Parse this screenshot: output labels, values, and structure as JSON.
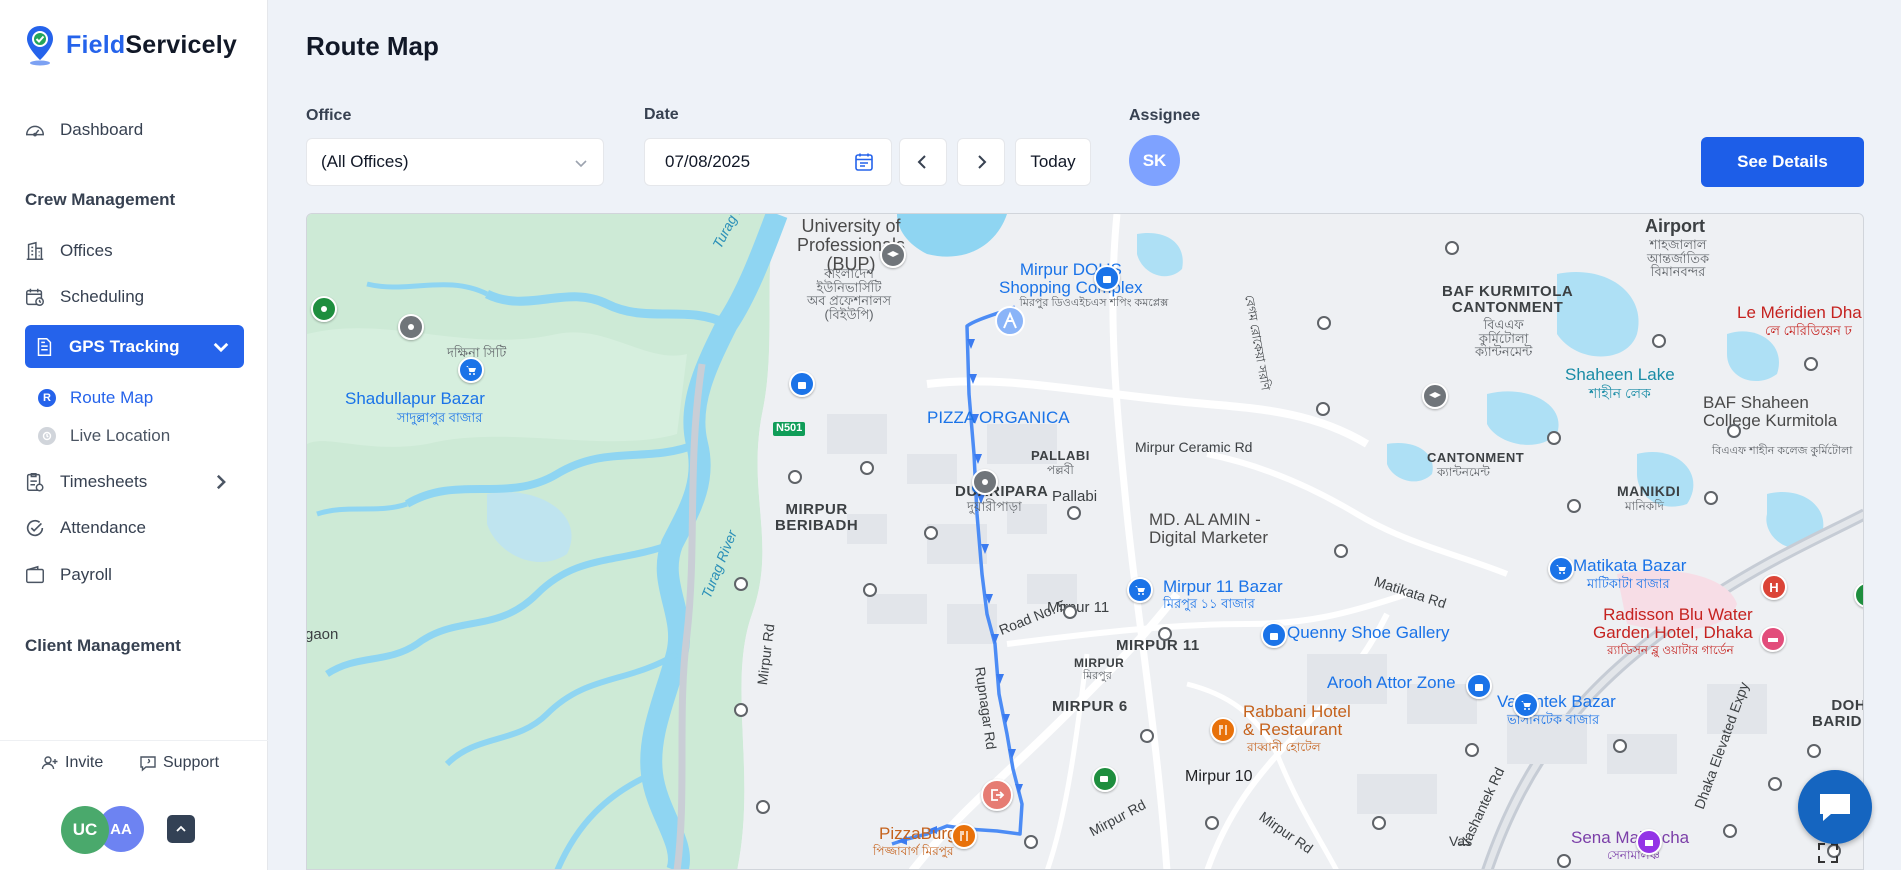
{
  "brand": {
    "name_part1": "Field",
    "name_part2": "Servicely"
  },
  "sidebar": {
    "dashboard": "Dashboard",
    "crew_section": "Crew Management",
    "offices": "Offices",
    "scheduling": "Scheduling",
    "gps_tracking": "GPS Tracking",
    "route_map": "Route Map",
    "route_map_badge": "R",
    "live_location": "Live Location",
    "timesheets": "Timesheets",
    "attendance": "Attendance",
    "payroll": "Payroll",
    "client_section": "Client Management",
    "invite": "Invite",
    "support": "Support",
    "avatars": [
      "UC",
      "AA"
    ]
  },
  "page": {
    "title": "Route Map",
    "office_label": "Office",
    "office_value": "(All Offices)",
    "date_label": "Date",
    "date_value": "07/08/2025",
    "today_label": "Today",
    "assignee_label": "Assignee",
    "assignee_initials": "SK",
    "details_button": "See Details"
  },
  "colors": {
    "accent": "#2563eb",
    "route": "#4c8cf5"
  },
  "map": {
    "labels": {
      "bup1": "University of",
      "bup2": "Professionals",
      "bup3": "(BUP)",
      "bup_bn1": "বাংলাদেশ",
      "bup_bn2": "ইউনিভার্সিটি",
      "bup_bn3": "অব প্রফেশনালস",
      "bup_bn4": "(বিইউপি)",
      "dohs1": "Mirpur DOHS",
      "dohs2": "Shopping Complex",
      "dohs_bn": "মিরপুর ডিওএইচএস শপিং কমপ্লেক্স",
      "airport": "Airport",
      "airport_bn1": "শাহজালাল",
      "airport_bn2": "আন্তর্জাতিক",
      "airport_bn3": "বিমানবন্দর",
      "baf1": "BAF KURMITOLA",
      "baf2": "CANTONMENT",
      "baf_bn1": "বিএএফ",
      "baf_bn2": "কুর্মিটোলা",
      "baf_bn3": "ক্যান্টনমেন্ট",
      "meridien": "Le Méridien Dha",
      "meridien_bn": "লে মেরিডিয়েন ঢ",
      "daksina": "দক্ষিনা সিটি",
      "shadullapur": "Shadullapur Bazar",
      "shadullapur_bn": "সাদুল্লাপুর বাজার",
      "pizza_organica": "PIZZA ORGANICA",
      "n501": "N501",
      "shaheen_lake": "Shaheen Lake",
      "shaheen_lake_bn": "শাহীন লেক",
      "baf_college1": "BAF Shaheen",
      "baf_college2": "College Kurmitola",
      "baf_college_bn": "বিএএফ শাহীন কলেজ কুর্মিটোলা",
      "pallabi_caps": "PALLABI",
      "pallabi_bn": "পল্লবী",
      "pallabi": "Pallabi",
      "mirpur_ceramic": "Mirpur Ceramic Rd",
      "cantonment": "CANTONMENT",
      "cantonment_bn": "ক্যান্টনমেন্ট",
      "manikdi": "MANIKDI",
      "manikdi_bn": "মানিকদি",
      "duaripara": "DUARIPARA",
      "duaripara_bn": "দুয়ারীপাড়া",
      "beribadh1": "MIRPUR",
      "beribadh2": "BERIBADH",
      "turag1": "Turag River",
      "turag2": "Turag River",
      "alamin1": "MD. AL AMIN -",
      "alamin2": "Digital Marketer",
      "mirpur11_bazar": "Mirpur 11 Bazar",
      "mirpur11_bazar_bn": "মিরপুর ১১ বাজার",
      "matikata_rd": "Matikata Rd",
      "matikata_bazar": "Matikata Bazar",
      "matikata_bazar_bn": "মাটিকাটা বাজার",
      "mirpur11_rd": "Mirpur 11",
      "road_no5": "Road No. 5",
      "mirpur11_caps": "MIRPUR 11",
      "quenny": "Quenny Shoe Gallery",
      "radisson1": "Radisson Blu Water",
      "radisson2": "Garden Hotel, Dhaka",
      "radisson_bn": "র‍্যাডিসন ব্লু ওয়াটার গার্ডেন",
      "gaon": "gaon",
      "mirpur_small": "MIRPUR",
      "mirpur_small_bn": "মিরপুর",
      "mirpur_rd1": "Mirpur Rd",
      "rupnagar": "Rupnagar Rd",
      "arooh": "Arooh Attor Zone",
      "mirpur6": "MIRPUR 6",
      "rabbani1": "Rabbani Hotel",
      "rabbani2": "& Restaurant",
      "rabbani_bn": "রাব্বানী হোটেল",
      "vasantek": "Vasantek Bazar",
      "vasantek_bn": "ভাসানটেক বাজার",
      "dohs_baridhara1": "DOHS",
      "dohs_baridhara2": "BARIDHAR",
      "dhaka_exp": "Dhaka Elevated Expy",
      "vashantek_rd": "Vashantek Rd",
      "mirpur10": "Mirpur 10",
      "mirpur_rd2": "Mirpur Rd",
      "mirpur_rd3": "Mirpur Rd",
      "pizzaburg": "PizzaBurg",
      "pizzaburg_bn": "পিজ্জাবার্গ মিরপুর",
      "sena": "Sena Malancha",
      "sena_bn": "সেনামালঞ্চ",
      "rokeya": "বেগম রোকেয়া সরণি",
      "vas": "Vas"
    }
  }
}
